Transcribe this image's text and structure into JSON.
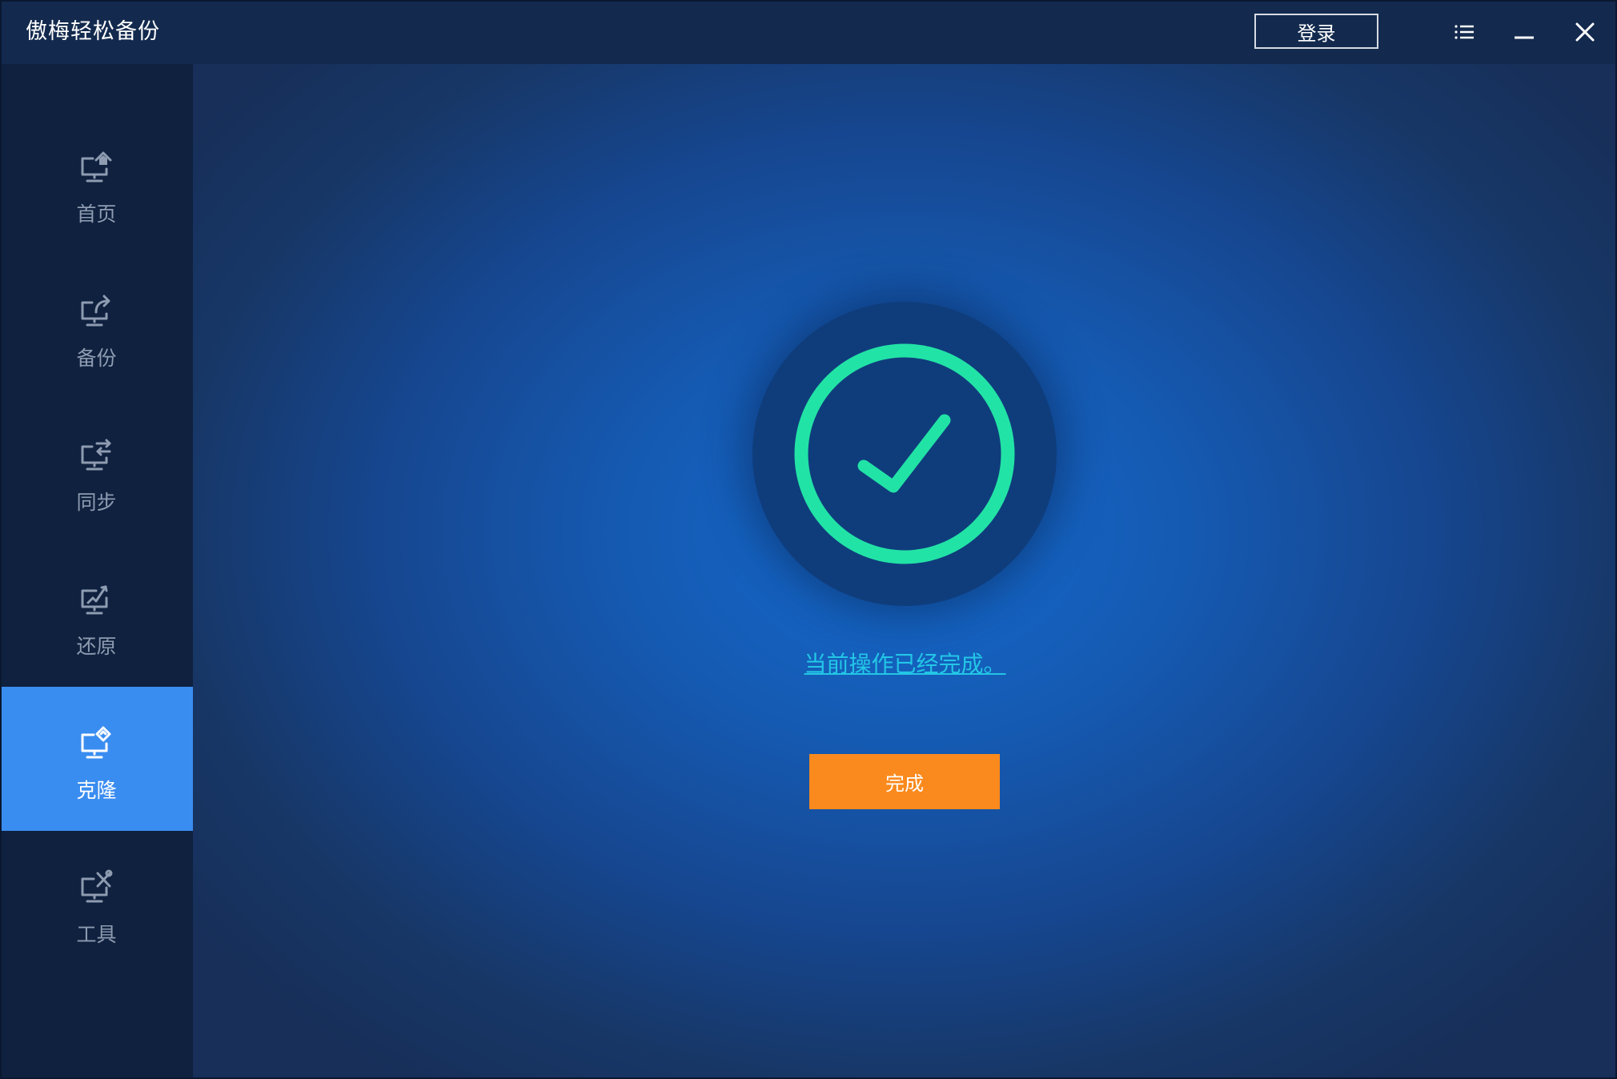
{
  "app": {
    "title": "傲梅轻松备份"
  },
  "titlebar": {
    "login_label": "登录",
    "menu_icon": "list-menu-icon",
    "minimize_icon": "minimize-icon",
    "close_icon": "close-icon"
  },
  "sidebar": {
    "items": [
      {
        "label": "首页",
        "icon": "home-icon",
        "active": false
      },
      {
        "label": "备份",
        "icon": "backup-icon",
        "active": false
      },
      {
        "label": "同步",
        "icon": "sync-icon",
        "active": false
      },
      {
        "label": "还原",
        "icon": "restore-icon",
        "active": false
      },
      {
        "label": "克隆",
        "icon": "clone-icon",
        "active": true
      },
      {
        "label": "工具",
        "icon": "tools-icon",
        "active": false
      }
    ]
  },
  "main": {
    "status_icon": "success-check-icon",
    "status_message": "当前操作已经完成。",
    "finish_label": "完成"
  },
  "colors": {
    "titlebar": "#132a4e",
    "sidebar": "#0f213f",
    "sidebar_active": "#3a8df0",
    "sidebar_text": "#8e9bb0",
    "main_center": "#1469cc",
    "main_edge": "#172f59",
    "badge_disc": "#0f3d7c",
    "ring": "#22e3a6",
    "link": "#23c6e6",
    "finish_button": "#fa8a1d"
  }
}
